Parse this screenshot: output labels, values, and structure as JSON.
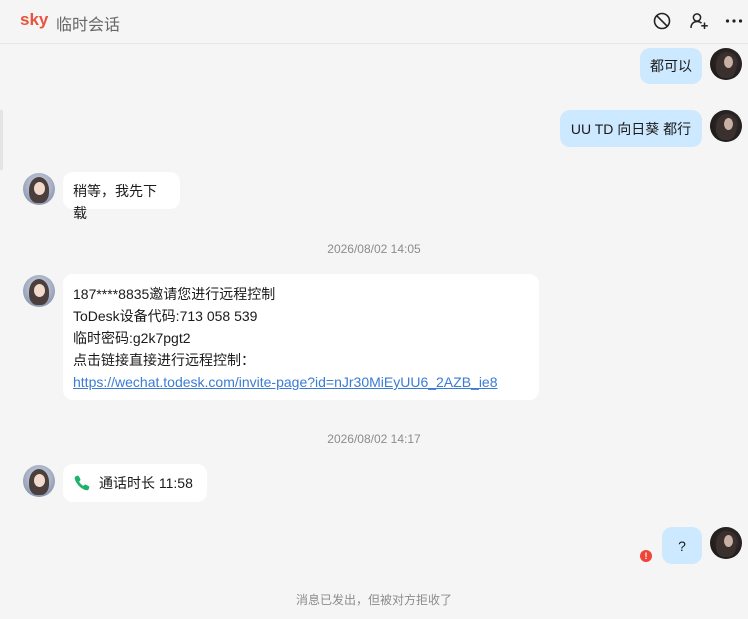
{
  "header": {
    "name": "sky",
    "subtitle": "临时会话",
    "icons": [
      "block-icon",
      "add-contact-icon",
      "more-icon"
    ]
  },
  "messages": {
    "m1": "都可以",
    "m2": "UU TD 向日葵 都行",
    "m3": "稍等，我先下载",
    "ts1": "2026/08/02 14:05",
    "m4_line1": "187****8835邀请您进行远程控制",
    "m4_line2": "ToDesk设备代码:713 058 539",
    "m4_line3": "临时密码:g2k7pgt2",
    "m4_line4": "点击链接直接进行远程控制：",
    "m4_link": "https://wechat.todesk.com/invite-page?id=nJr30MiEyUU6_2AZB_ie8",
    "ts2": "2026/08/02 14:17",
    "m5_call": "通话时长 11:58",
    "m6": "?",
    "m6_error": "!"
  },
  "footer": {
    "status": "消息已发出，但被对方拒收了"
  },
  "colors": {
    "brand": "#e8533d",
    "my_bubble": "#cde9ff",
    "their_bubble": "#ffffff",
    "link": "#3a7bd5",
    "error": "#f04438",
    "call_icon": "#1fb26b"
  }
}
